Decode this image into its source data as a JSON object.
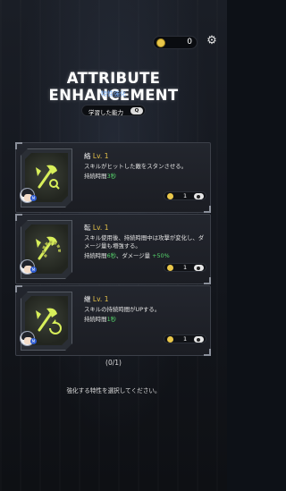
{
  "currency": {
    "icon": "coin-icon",
    "value": "0"
  },
  "settings": {
    "icon": "gear-icon",
    "glyph": "⚙"
  },
  "header": {
    "title": "ATTRIBUTE ENHANCEMENT",
    "subtitle": "特性強化",
    "learned_button": "学習した能力",
    "learned_q": "Q"
  },
  "cards": [
    {
      "name": "絡",
      "level": "Lv. 1",
      "desc": "スキルがヒットした敵をスタンさせる。",
      "stat_prefix": "持続時間",
      "stat_hl": "3秒",
      "stat_rest": "",
      "cost": "1",
      "icon": "stun-axe-icon"
    },
    {
      "name": "転",
      "level": "Lv. 1",
      "desc": "スキル使用後、持続時間中は攻撃が変化し、ダメージ量も増強する。",
      "stat_prefix": "持続時間",
      "stat_hl": "6秒",
      "stat_mid": "、ダメージ量 ",
      "stat_hl2": "+50%",
      "cost": "1",
      "icon": "transform-axe-icon"
    },
    {
      "name": "継",
      "level": "Lv. 1",
      "desc": "スキルの持続時間がUPする。",
      "stat_prefix": "持続時間",
      "stat_hl": "1秒",
      "stat_rest": "",
      "cost": "1",
      "icon": "duration-axe-icon"
    }
  ],
  "progress": "(0/1)",
  "prompt": "強化する特性を選択してください。",
  "colors": {
    "accent_yellow": "#e6c34a",
    "accent_green": "#56d56c",
    "subtitle_blue": "#7fb5ff",
    "icon_lime": "#d8ef5a"
  }
}
